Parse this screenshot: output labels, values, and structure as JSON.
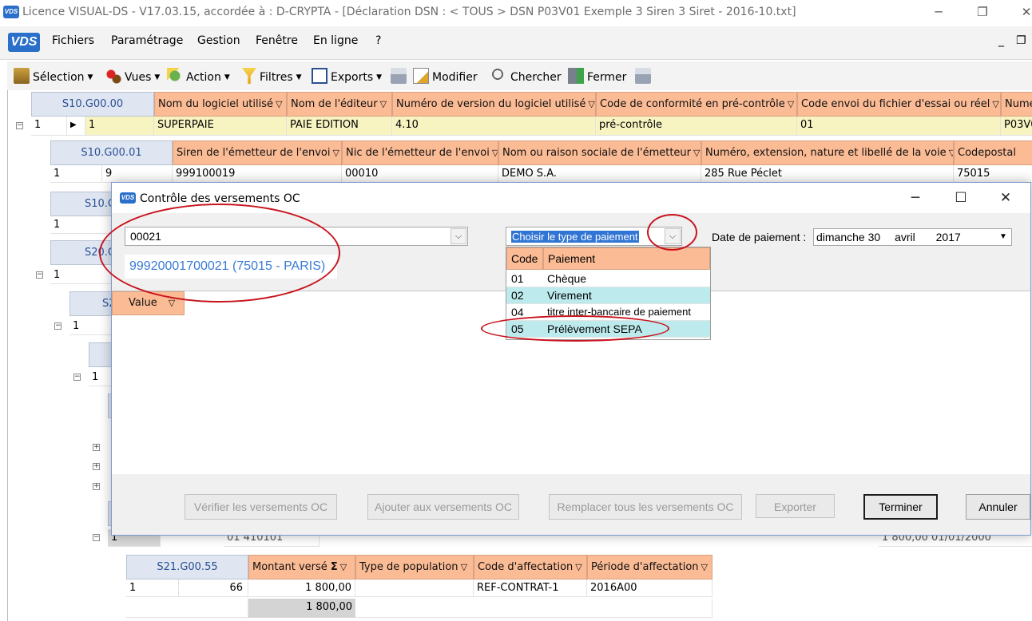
{
  "window": {
    "title": "Licence VISUAL-DS  -  V17.03.15, accordée à : D-CRYPTA - [Déclaration DSN :  < TOUS > DSN P03V01 Exemple 3 Siren 3 Siret - 2016-10.txt]",
    "logo": "VDS"
  },
  "menubar": {
    "items": [
      "Fichiers",
      "Paramétrage",
      "Gestion",
      "Fenêtre",
      "En ligne",
      "?"
    ]
  },
  "toolbar": {
    "selection": "Sélection",
    "vues": "Vues",
    "action": "Action",
    "filtres": "Filtres",
    "exports": "Exports",
    "modifier": "Modifier",
    "chercher": "Chercher",
    "fermer": "Fermer"
  },
  "grid": {
    "s10g0000": {
      "key": "S10.G00.00",
      "headers": [
        "Nom du logiciel utilisé",
        "Nom de l'éditeur",
        "Numéro de version du logiciel utilisé",
        "Code de conformité en pré-contrôle",
        "Code envoi du fichier d'essai ou réel",
        "Numé"
      ],
      "row": {
        "num": "1",
        "idx": "1",
        "values": [
          "SUPERPAIE",
          "PAIE EDITION",
          "4.10",
          "pré-contrôle",
          "01",
          "P03V0"
        ]
      }
    },
    "s10g0001": {
      "key": "S10.G00.01",
      "headers": [
        "Siren de l'émetteur de l'envoi",
        "Nic de l'émetteur de l'envoi",
        "Nom ou raison sociale de l'émetteur",
        "Numéro, extension, nature et libellé de la voie",
        "Codepostal"
      ],
      "row": {
        "num": "1",
        "idx": "9",
        "values": [
          "999100019",
          "00010",
          "DEMO S.A.",
          "285 Rue Péclet",
          "75015"
        ]
      }
    },
    "s10g_partial": "S10.G",
    "s20g_partial": "S20.G",
    "s2_partial": "S2",
    "row_one": "1",
    "row_one_b": "1",
    "row_one_c": "1",
    "row_one_d": "1",
    "row_one_e": "1",
    "hidden_row_left": "01 410101",
    "hidden_row_right": "1 800,00  01/01/2000",
    "s21g0055": {
      "key": "S21.G00.55",
      "headers": [
        "Montant versé",
        "Type de population",
        "Code d'affectation",
        "Période d'affectation"
      ],
      "row": {
        "num": "1",
        "idx": "66",
        "values": [
          "1 800,00",
          "",
          "REF-CONTRAT-1",
          "2016A00"
        ]
      },
      "total": "1 800,00"
    }
  },
  "dialog": {
    "title": "Contrôle des versements OC",
    "combo_value": "00021",
    "combo_detail": "99920001700021 (75015 - PARIS)",
    "payment_type_placeholder": "Choisir le type de paiement",
    "date_label": "Date de paiement :",
    "date_day": "dimanche 30",
    "date_month": "avril",
    "date_year": "2017",
    "value_header": "Value",
    "dropdown": {
      "header_code": "Code",
      "header_paiement": "Paiement",
      "rows": [
        {
          "code": "01",
          "label": "Chèque"
        },
        {
          "code": "02",
          "label": "Virement"
        },
        {
          "code": "04",
          "label": "titre inter-bancaire de paiement"
        },
        {
          "code": "05",
          "label": "Prélèvement SEPA"
        }
      ]
    },
    "buttons": {
      "verifier": "Vérifier les versements OC",
      "ajouter": "Ajouter aux versements OC",
      "remplacer": "Remplacer tous les versements OC",
      "exporter": "Exporter",
      "terminer": "Terminer",
      "annuler": "Annuler"
    }
  },
  "colors": {
    "header_orange": "#fbbb95",
    "key_blue": "#dfe6f1",
    "highlight_row": "#f8f4c1",
    "dropdown_highlight": "#bdebed",
    "annotation_red": "#c8141e"
  }
}
